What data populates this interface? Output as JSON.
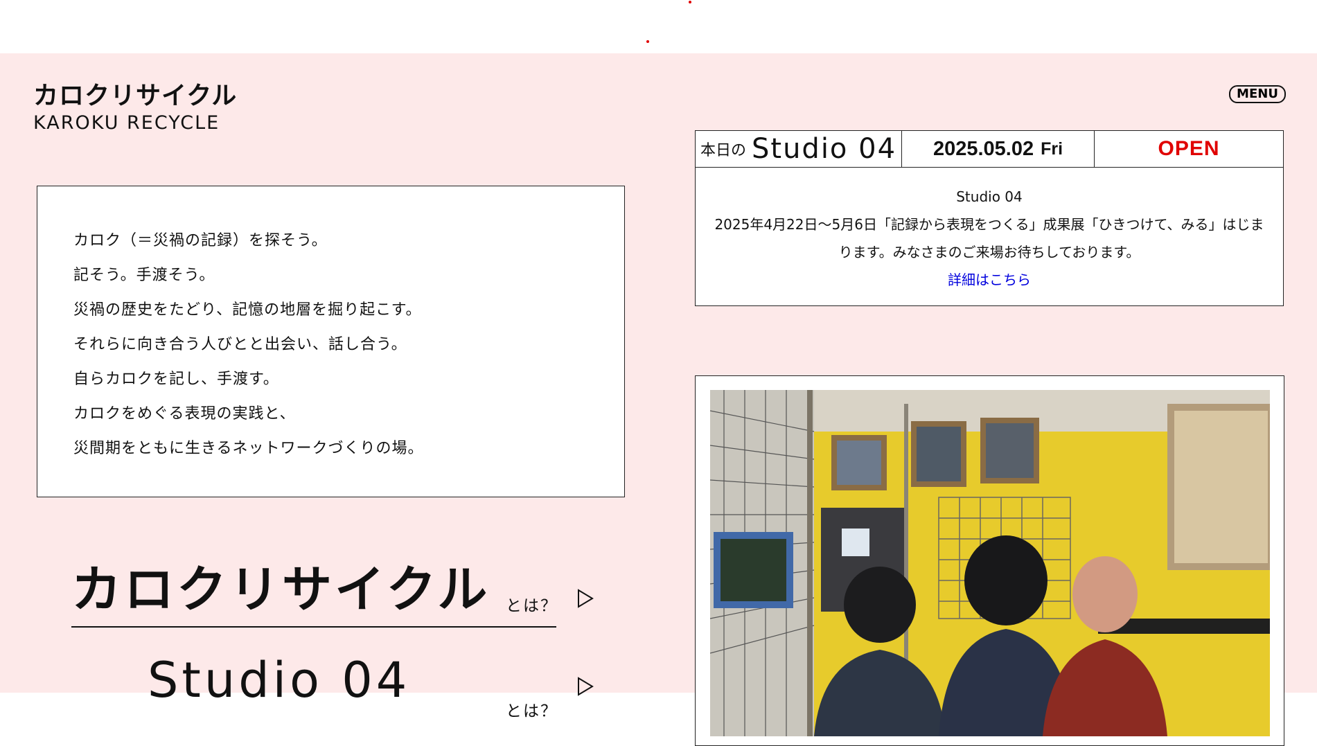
{
  "logo": {
    "jp": "カロクリサイクル",
    "en": "KAROKU RECYCLE"
  },
  "menu": {
    "label": "MENU"
  },
  "intro": {
    "lines": [
      "カロク（＝災禍の記録）を探そう。",
      "記そう。手渡そう。",
      "災禍の歴史をたどり、記憶の地層を掘り起こす。",
      "それらに向き合う人びとと出会い、話し合う。",
      "自らカロクを記し、手渡す。",
      "カロクをめぐる表現の実践と、",
      "災間期をともに生きるネットワークづくりの場。"
    ]
  },
  "today": {
    "prefix": "本日の",
    "studio": "Studio 04",
    "date": "2025.05.02",
    "weekday": "Fri",
    "status": "OPEN",
    "status_color": "#e00000",
    "notice_title": "Studio 04",
    "notice_text": "2025年4月22日〜5月6日「記録から表現をつくる」成果展「ひきつけて、みる」はじまります。みなさまのご来場お待ちしております。",
    "link_label": "詳細はこちら"
  },
  "nav": [
    {
      "title": "カロクリサイクル",
      "suffix": "とは？"
    },
    {
      "title": "Studio 04",
      "suffix": "とは？"
    }
  ],
  "colors": {
    "background": "#fde9e9",
    "link": "#0000dd",
    "accent": "#e00000"
  }
}
